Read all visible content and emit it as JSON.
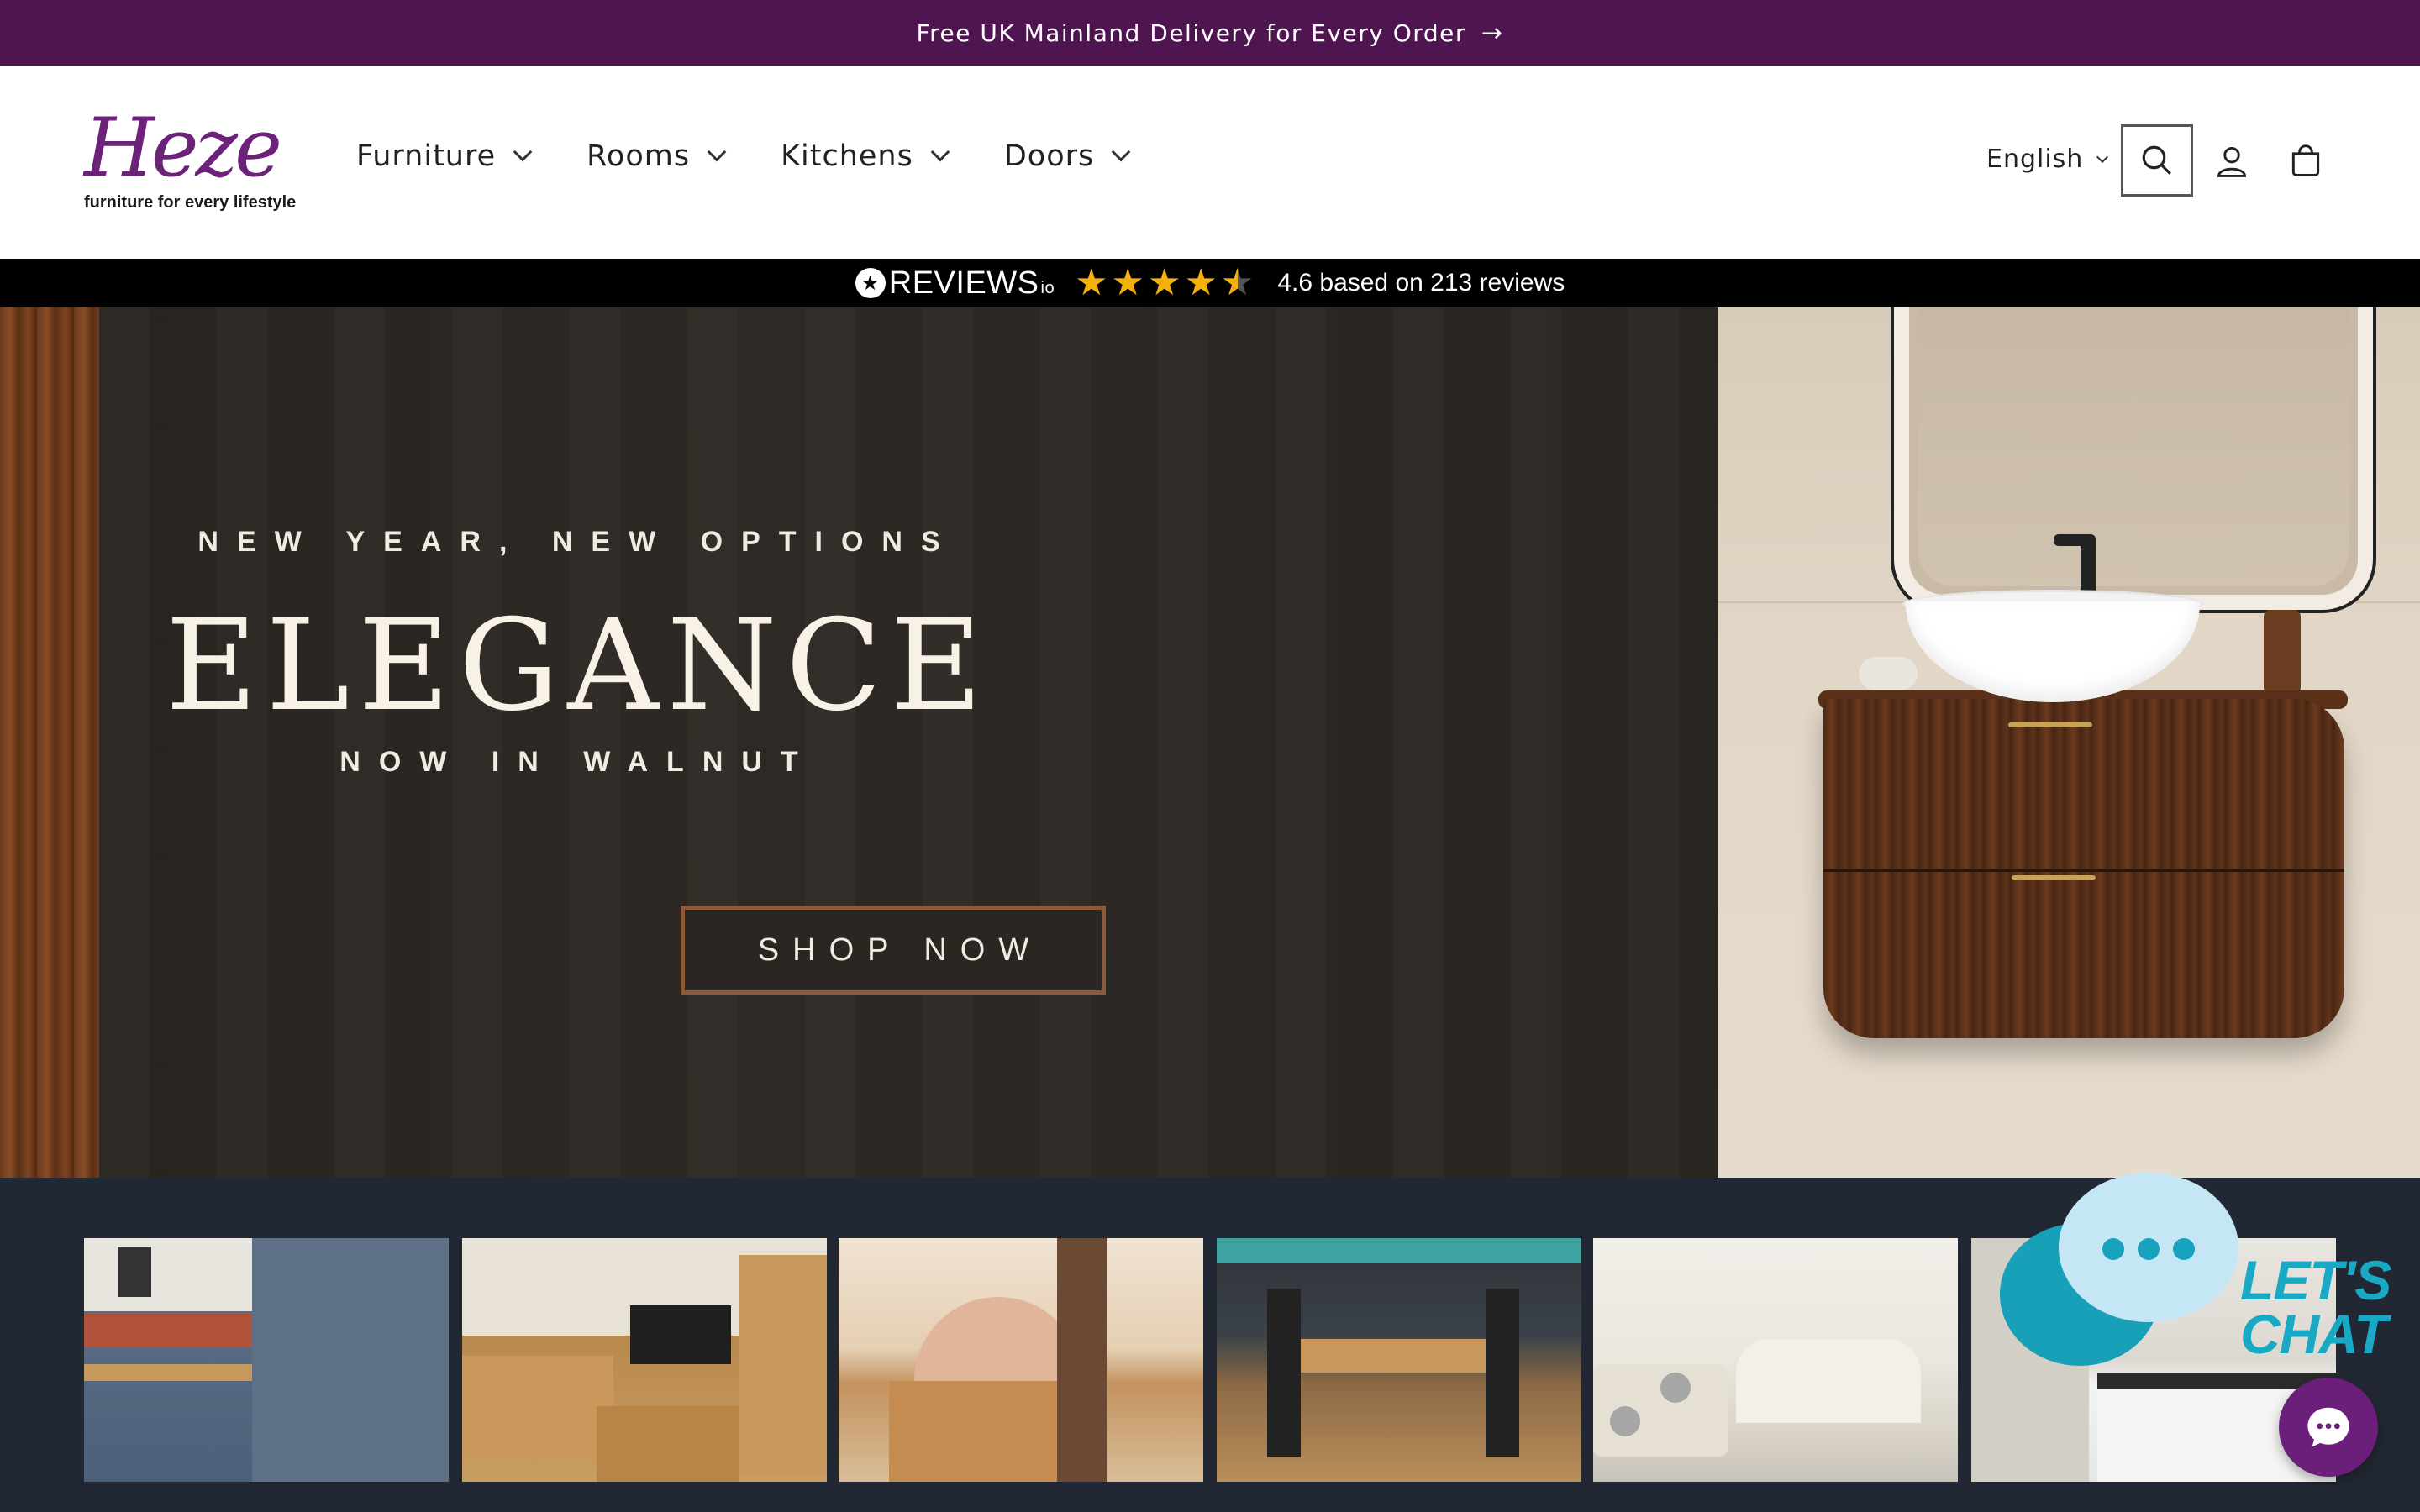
{
  "announcement": {
    "text": "Free UK Mainland Delivery for Every Order",
    "arrow": "→"
  },
  "header": {
    "logo_word": "Heze",
    "logo_tagline": "furniture for every lifestyle",
    "nav": [
      {
        "label": "Furniture"
      },
      {
        "label": "Rooms"
      },
      {
        "label": "Kitchens"
      },
      {
        "label": "Doors"
      }
    ],
    "language": "English",
    "icons": [
      "search-icon",
      "account-icon",
      "cart-icon"
    ]
  },
  "reviews": {
    "brand": "REVIEWS",
    "brand_suffix": "io",
    "rating_stars": 4.6,
    "summary": "4.6 based on 213 reviews"
  },
  "hero": {
    "kicker": "NEW YEAR, NEW OPTIONS",
    "headline": "ELEGANCE",
    "subline": "NOW IN WALNUT",
    "cta": "SHOP NOW",
    "close": "✕"
  },
  "chat": {
    "line1": "LET'S",
    "line2": "CHAT"
  },
  "colors": {
    "announcement_bg": "#4f1550",
    "brand_purple": "#6b2278",
    "reviews_bg": "#000000",
    "star": "#f5b10a",
    "gallery_bg": "#222833",
    "chat_accent": "#19a9c4",
    "chat_button": "#6b1f7a"
  }
}
